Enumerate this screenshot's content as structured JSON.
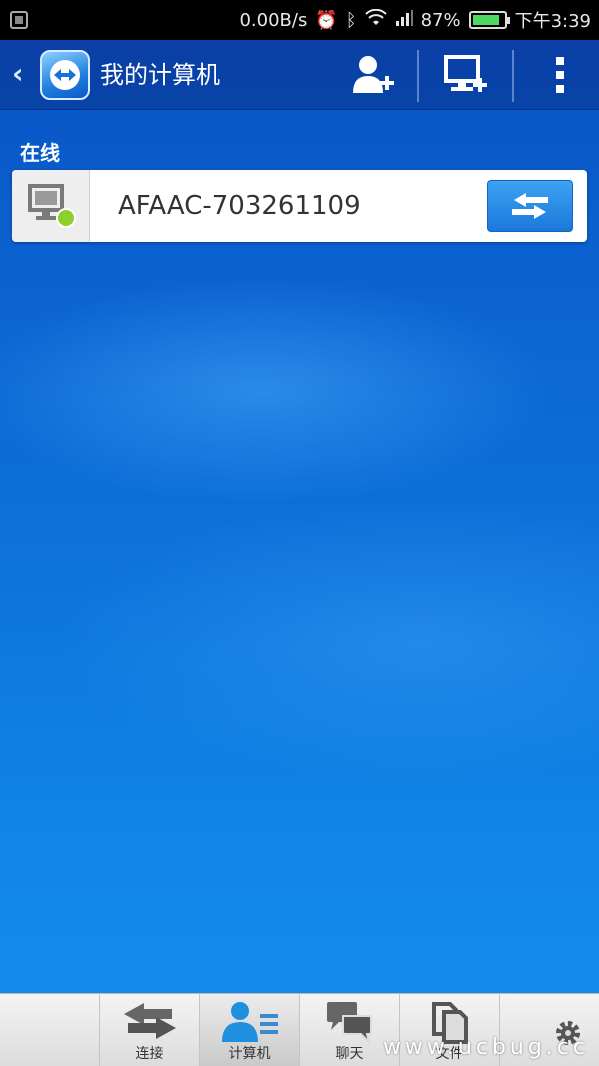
{
  "status_bar": {
    "network_speed": "0.00B/s",
    "battery_percent": "87%",
    "battery_level": 0.87,
    "time": "下午3:39"
  },
  "header": {
    "title": "我的计算机"
  },
  "section": {
    "label": "在线"
  },
  "computers": [
    {
      "name": "AFAAC-703261109",
      "status": "online"
    }
  ],
  "bottom_nav": {
    "items": [
      {
        "label": "连接",
        "icon": "swap-arrows-icon"
      },
      {
        "label": "计算机",
        "icon": "contacts-icon"
      },
      {
        "label": "聊天",
        "icon": "chat-icon"
      },
      {
        "label": "文件",
        "icon": "files-icon"
      }
    ],
    "watermark": "www.ucbug.cc"
  },
  "colors": {
    "header": "#0a3fa6",
    "online": "#8ed02a",
    "connect_button": "#1a78db"
  }
}
